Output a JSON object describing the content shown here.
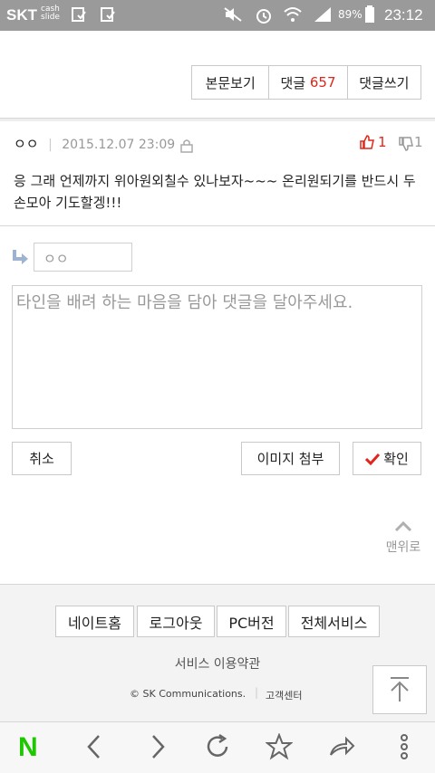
{
  "status_bar": {
    "carrier": "SKT",
    "cash_line1": "cash",
    "cash_line2": "slide",
    "battery": "89%",
    "time": "23:12"
  },
  "article_toolbar": {
    "view_body": "본문보기",
    "comments_label": "댓글",
    "comments_count": "657",
    "write_comment": "댓글쓰기"
  },
  "comment": {
    "author": "ㅇㅇ",
    "datetime": "2015.12.07 23:09",
    "likes": "1",
    "dislikes": "1",
    "text": "응 그래 언제까지 위아원외칠수 있나보자~~~ 온리원되기를 반드시 두손모아 기도할겡!!!"
  },
  "reply_form": {
    "nickname_value": "ㅇㅇ",
    "textarea_placeholder": "타인을 배려 하는 마음을 담아 댓글을 달아주세요.",
    "cancel": "취소",
    "attach_image": "이미지 첨부",
    "confirm": "확인"
  },
  "top_link": "맨위로",
  "footer": {
    "buttons": [
      "네이트홈",
      "로그아웃",
      "PC버전",
      "전체서비스"
    ],
    "terms": "서비스 이용약관",
    "copyright": "© SK Communications.",
    "support": "고객센터"
  },
  "colors": {
    "accent_red": "#e0261b",
    "status_bar": "#9a9a9a",
    "naver_green": "#1ec800"
  },
  "browser_nav": {
    "icons": [
      "naver-n-icon",
      "back-icon",
      "forward-icon",
      "refresh-icon",
      "bookmark-star-icon",
      "share-icon",
      "more-icon"
    ],
    "naver_letter": "N"
  }
}
